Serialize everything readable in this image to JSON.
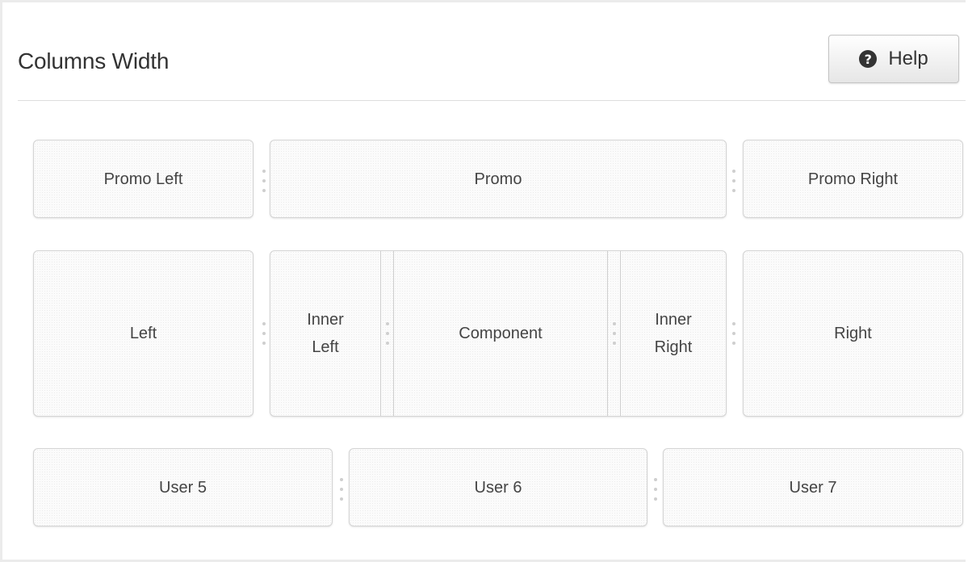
{
  "header": {
    "title": "Columns Width",
    "help_label": "Help",
    "help_icon": "question-circle-icon"
  },
  "rows": {
    "promo": {
      "left": "Promo Left",
      "center": "Promo",
      "right": "Promo Right"
    },
    "main": {
      "left": "Left",
      "inner_left_line1": "Inner",
      "inner_left_line2": "Left",
      "component": "Component",
      "inner_right_line1": "Inner",
      "inner_right_line2": "Right",
      "right": "Right"
    },
    "user": {
      "user5": "User 5",
      "user6": "User 6",
      "user7": "User 7"
    }
  },
  "icons": {
    "resize_handle": "drag-handle-icon"
  }
}
